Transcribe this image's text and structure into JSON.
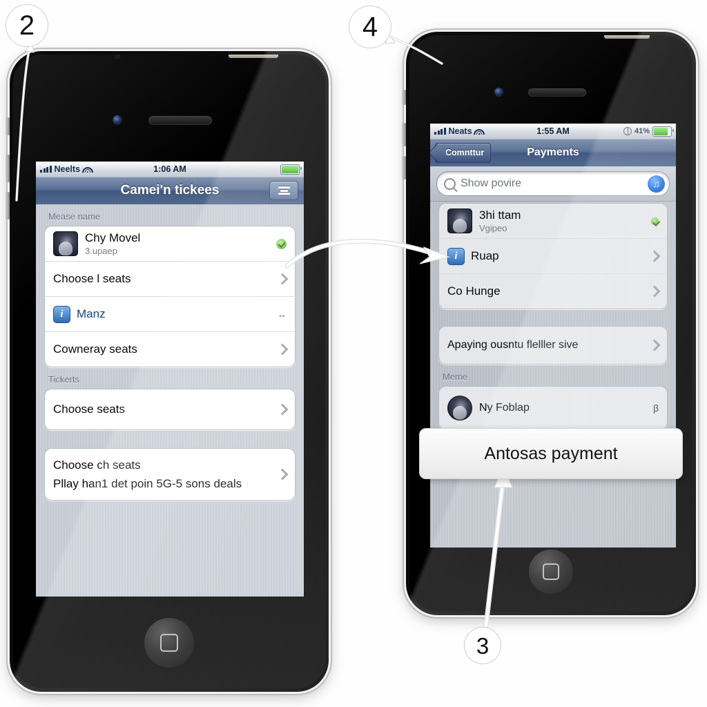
{
  "callouts": [
    {
      "id": "2",
      "label": "2"
    },
    {
      "id": "4",
      "label": "4"
    },
    {
      "id": "3",
      "label": "3"
    }
  ],
  "phone_left": {
    "status_bar": {
      "signal_icon": "signal-bars-icon",
      "carrier": "Neelts",
      "wifi_icon": "wifi-icon",
      "time": "1:06 AM",
      "battery_icon": "battery-icon"
    },
    "nav_bar": {
      "title": "Camei'n tickees",
      "right_button_icon": "list-lines-icon"
    },
    "sections": [
      {
        "label": "Mease name",
        "rows": [
          {
            "type": "avatar",
            "avatar_icon": "contact-avatar",
            "title": "Chy Movel",
            "subtitle": "3.upaep",
            "accessory": "green-refresh-badge"
          },
          {
            "type": "plain",
            "title": "Choose l seats",
            "accessory": "chevron-right-icon"
          },
          {
            "type": "info",
            "icon": "info-blue-icon",
            "title": "Manz",
            "accessory": "double-arrow-icon"
          },
          {
            "type": "plain",
            "title": "Cowneray seats",
            "accessory": "chevron-right-icon"
          }
        ]
      },
      {
        "label": "Tickerts",
        "rows": [
          {
            "type": "plain",
            "title": "Choose seats",
            "accessory": "chevron-right-icon"
          }
        ]
      },
      {
        "label": "",
        "rows": [
          {
            "type": "twoline",
            "title": "Choose ch seats",
            "subtitle": "Pllay han1 det poin 5G-5 sons deals",
            "accessory": "chevron-right-icon"
          }
        ]
      }
    ]
  },
  "phone_right": {
    "status_bar": {
      "signal_icon": "signal-bars-icon",
      "carrier": "Neats",
      "wifi_icon": "wifi-icon",
      "time": "1:55 AM",
      "lock_icon": "do-not-disturb-icon",
      "battery_percent": "41%",
      "battery_icon": "battery-icon"
    },
    "nav_bar": {
      "back_label": "Comnttur",
      "title": "Payments"
    },
    "search": {
      "placeholder": "Show povire",
      "icon": "search-icon",
      "mic_icon": "mic-button-icon"
    },
    "sections": [
      {
        "label": "",
        "rows": [
          {
            "type": "avatar",
            "avatar_icon": "contact-avatar",
            "title": "3hi ttam",
            "subtitle": "Vgipeo",
            "accessory": "green-badge"
          },
          {
            "type": "info",
            "icon": "info-blue-icon",
            "title": "Ruap",
            "accessory": "chevron-right-icon"
          },
          {
            "type": "plain",
            "title": "Co Hunge",
            "accessory": "chevron-right-icon"
          }
        ]
      },
      {
        "label": "",
        "rows": [
          {
            "type": "plain",
            "title": "Apaying ousntu flelller sive",
            "accessory": "chevron-right-icon"
          }
        ]
      },
      {
        "label": "Meme",
        "rows": [
          {
            "type": "avatar-round",
            "avatar_icon": "contact-avatar",
            "title": "Ny Foblap",
            "subtitle": "",
            "accessory": "b-glyph"
          }
        ]
      }
    ]
  },
  "tooltip": {
    "label": "Antosas payment"
  },
  "colors": {
    "nav_blue": "#51688c",
    "status_text": "#13304f",
    "row_text": "#0a0a0a",
    "section_label": "#697484",
    "accent_blue": "#1f6ede",
    "badge_green": "#4ea72b",
    "screen_bg": "#c8ccd4"
  }
}
